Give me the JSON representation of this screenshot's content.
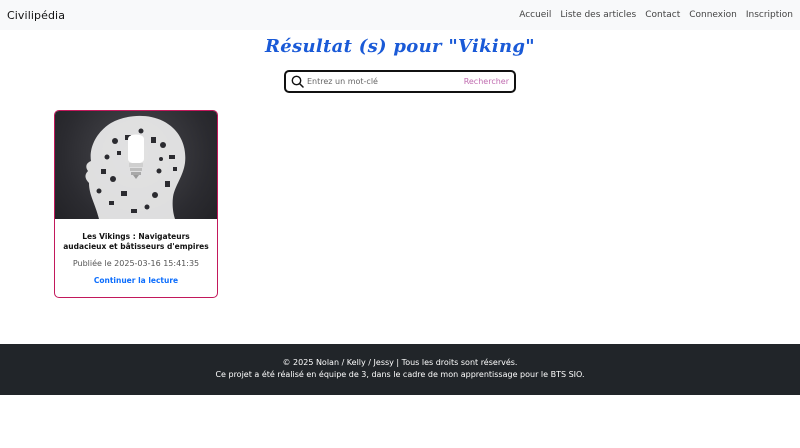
{
  "navbar": {
    "brand": "Civilipédia",
    "links": [
      "Accueil",
      "Liste des articles",
      "Contact",
      "Connexion",
      "Inscription"
    ]
  },
  "page": {
    "title": "Résultat (s) pour \"Viking\""
  },
  "search": {
    "placeholder": "Entrez un mot-clé",
    "value": "",
    "button_label": "Rechercher"
  },
  "results": [
    {
      "title": "Les Vikings : Navigateurs audacieux et bâtisseurs d'empires",
      "date": "Publiée le 2025-03-16 15:41:35",
      "link_label": "Continuer la lecture"
    }
  ],
  "footer": {
    "line1": "© 2025 Nolan / Kelly / Jessy | Tous les droits sont réservés.",
    "line2": "Ce projet a été réalisé en équipe de 3, dans le cadre de mon apprentissage pour le BTS SIO."
  },
  "colors": {
    "title": "#1a5ad7",
    "card_border": "#c2185b",
    "search_button": "#c06cb0",
    "link": "#0d6efd",
    "footer_bg": "#212529",
    "navbar_bg": "#f8f9fa"
  }
}
